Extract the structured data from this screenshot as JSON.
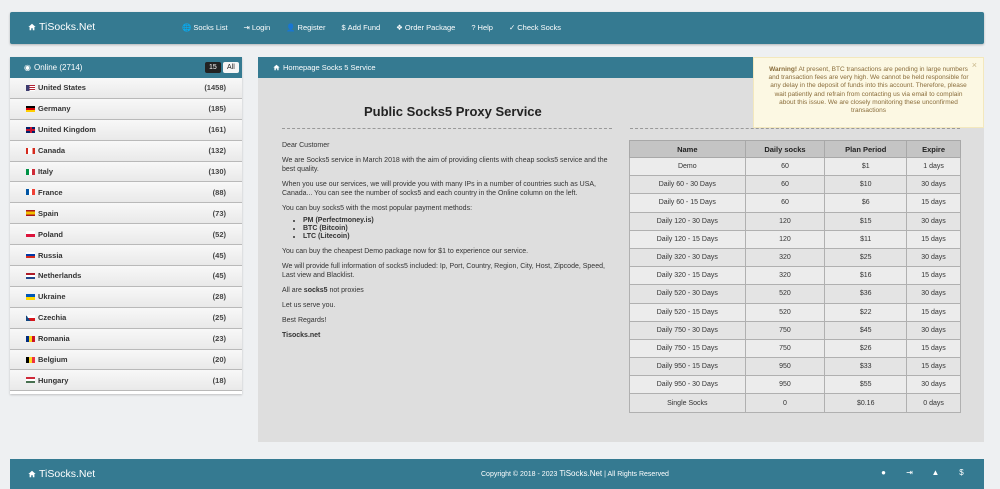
{
  "nav": {
    "brand": "TiSocks.Net",
    "items": [
      {
        "icon": "globe-icon",
        "glyph": "🌐",
        "label": "Socks List"
      },
      {
        "icon": "login-icon",
        "glyph": "⇥",
        "label": "Login"
      },
      {
        "icon": "user-icon",
        "glyph": "👤",
        "label": "Register"
      },
      {
        "icon": "dollar-icon",
        "glyph": "$",
        "label": "Add Fund"
      },
      {
        "icon": "cubes-icon",
        "glyph": "❖",
        "label": "Order Package"
      },
      {
        "icon": "question-icon",
        "glyph": "?",
        "label": "Help"
      },
      {
        "icon": "check-icon",
        "glyph": "✓",
        "label": "Check Socks"
      }
    ]
  },
  "sidebar": {
    "title": "Online (2714)",
    "btn_15": "15",
    "btn_all": "All",
    "countries": [
      {
        "name": "United States",
        "count": "(1458)",
        "flag": "us"
      },
      {
        "name": "Germany",
        "count": "(185)",
        "flag": "de"
      },
      {
        "name": "United Kingdom",
        "count": "(161)",
        "flag": "gb"
      },
      {
        "name": "Canada",
        "count": "(132)",
        "flag": "ca"
      },
      {
        "name": "Italy",
        "count": "(130)",
        "flag": "it"
      },
      {
        "name": "France",
        "count": "(88)",
        "flag": "fr"
      },
      {
        "name": "Spain",
        "count": "(73)",
        "flag": "es"
      },
      {
        "name": "Poland",
        "count": "(52)",
        "flag": "pl"
      },
      {
        "name": "Russia",
        "count": "(45)",
        "flag": "ru"
      },
      {
        "name": "Netherlands",
        "count": "(45)",
        "flag": "nl"
      },
      {
        "name": "Ukraine",
        "count": "(28)",
        "flag": "ua"
      },
      {
        "name": "Czechia",
        "count": "(25)",
        "flag": "cz"
      },
      {
        "name": "Romania",
        "count": "(23)",
        "flag": "ro"
      },
      {
        "name": "Belgium",
        "count": "(20)",
        "flag": "be"
      },
      {
        "name": "Hungary",
        "count": "(18)",
        "flag": "hu"
      }
    ]
  },
  "main": {
    "header": "Homepage Socks 5 Service",
    "title": "Public Socks5 Proxy Service",
    "greeting": "Dear Customer",
    "p1": "We are Socks5 service in March 2018 with the aim of providing clients with cheap socks5 service and the best quality.",
    "p2": "When you use our services, we will provide you with many IPs in a number of countries such as USA, Canada... You can see the number of socks5 and each country in the Online column on the left.",
    "p3": "You can buy socks5 with the most popular payment methods:",
    "methods": [
      "PM (Perfectmoney.is)",
      "BTC (Bitcoin)",
      "LTC (Litecoin)"
    ],
    "p4": "You can buy the cheapest Demo package now for $1 to experience our service.",
    "p5": "We will provide full information of socks5 included: Ip, Port, Country, Region, City, Host, Zipcode, Speed, Last view and Blacklist.",
    "p6_pre": "All are ",
    "p6_bold": "socks5",
    "p6_post": " not proxies",
    "p7": "Let us serve you.",
    "p8": "Best Regards!",
    "signature": "Tisocks.net"
  },
  "plans": {
    "headers": [
      "Name",
      "Daily socks",
      "Plan Period",
      "Expire"
    ],
    "rows": [
      [
        "Demo",
        "60",
        "$1",
        "1 days"
      ],
      [
        "Daily 60 - 30 Days",
        "60",
        "$10",
        "30 days"
      ],
      [
        "Daily 60 - 15 Days",
        "60",
        "$6",
        "15 days"
      ],
      [
        "Daily 120 - 30 Days",
        "120",
        "$15",
        "30 days"
      ],
      [
        "Daily 120 - 15 Days",
        "120",
        "$11",
        "15 days"
      ],
      [
        "Daily 320 - 30 Days",
        "320",
        "$25",
        "30 days"
      ],
      [
        "Daily 320 - 15 Days",
        "320",
        "$16",
        "15 days"
      ],
      [
        "Daily 520 - 30 Days",
        "520",
        "$36",
        "30 days"
      ],
      [
        "Daily 520 - 15 Days",
        "520",
        "$22",
        "15 days"
      ],
      [
        "Daily 750 - 30 Days",
        "750",
        "$45",
        "30 days"
      ],
      [
        "Daily 750 - 15 Days",
        "750",
        "$26",
        "15 days"
      ],
      [
        "Daily 950 - 15 Days",
        "950",
        "$33",
        "15 days"
      ],
      [
        "Daily 950 - 30 Days",
        "950",
        "$55",
        "30 days"
      ],
      [
        "Single Socks",
        "0",
        "$0.16",
        "0 days"
      ]
    ]
  },
  "warning": {
    "label": "Warning!",
    "text": " At present, BTC transactions are pending in large numbers and transaction fees are very high. We cannot be held responsible for any delay in the deposit of funds into this account. Therefore, please wait patiently and refrain from contacting us via email to complain about this issue. We are closely monitoring these unconfirmed transactions",
    "close": "×"
  },
  "footer": {
    "brand": "TiSocks.Net",
    "copy_pre": "Copyright © 2018 - 2023 ",
    "copy_brand": "TiSocks.Net",
    "copy_post": " | All Rights Reserved",
    "icons": [
      {
        "name": "globe-icon",
        "glyph": "●"
      },
      {
        "name": "login-icon",
        "glyph": "⇥"
      },
      {
        "name": "user-icon",
        "glyph": "▲"
      },
      {
        "name": "dollar-icon",
        "glyph": "$"
      }
    ]
  },
  "colors": {
    "accent": "#357a91",
    "warning_bg": "#fcf8e3",
    "warning_text": "#8a6d3b"
  }
}
